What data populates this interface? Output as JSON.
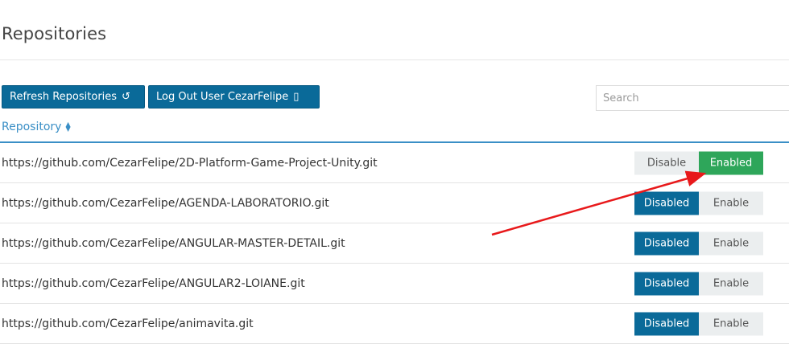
{
  "page": {
    "title": "Repositories"
  },
  "toolbar": {
    "refresh_label": "Refresh Repositories",
    "refresh_icon": "↺",
    "logout_label": "Log Out User CezarFelipe",
    "logout_icon": "▯"
  },
  "search": {
    "placeholder": "Search"
  },
  "table": {
    "column_header": "Repository",
    "rows": [
      {
        "url": "https://github.com/CezarFelipe/2D-Platform-Game-Project-Unity.git",
        "disable_label": "Disable",
        "enable_label": "Enabled",
        "state": "enabled"
      },
      {
        "url": "https://github.com/CezarFelipe/AGENDA-LABORATORIO.git",
        "disable_label": "Disabled",
        "enable_label": "Enable",
        "state": "disabled"
      },
      {
        "url": "https://github.com/CezarFelipe/ANGULAR-MASTER-DETAIL.git",
        "disable_label": "Disabled",
        "enable_label": "Enable",
        "state": "disabled"
      },
      {
        "url": "https://github.com/CezarFelipe/ANGULAR2-LOIANE.git",
        "disable_label": "Disabled",
        "enable_label": "Enable",
        "state": "disabled"
      },
      {
        "url": "https://github.com/CezarFelipe/animavita.git",
        "disable_label": "Disabled",
        "enable_label": "Enable",
        "state": "disabled"
      }
    ]
  },
  "colors": {
    "primary": "#0a6a99",
    "enabled": "#2ea65a",
    "link": "#3a8fc6",
    "annotation_arrow": "#e8191b"
  }
}
